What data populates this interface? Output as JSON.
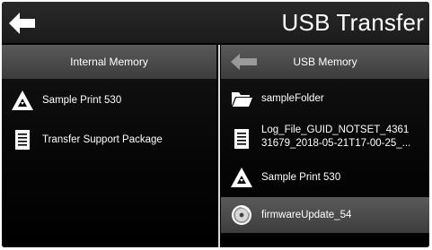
{
  "header": {
    "title": "USB Transfer",
    "back_icon": "arrow-left-icon"
  },
  "internal": {
    "heading": "Internal Memory",
    "items": [
      {
        "label": "Sample Print 530",
        "icon": "print-file-icon"
      },
      {
        "label": "Transfer Support Package",
        "icon": "document-icon"
      }
    ]
  },
  "usb": {
    "heading": "USB Memory",
    "back_icon": "arrow-left-icon",
    "items": [
      {
        "label": "sampleFolder",
        "icon": "folder-icon"
      },
      {
        "label_line1": "Log_File_GUID_NOTSET_4361",
        "label_line2": "31679_2018-05-21T17-00-25_...",
        "icon": "document-icon"
      },
      {
        "label": "Sample Print 530",
        "icon": "print-file-icon"
      },
      {
        "label": "firmwareUpdate_54",
        "icon": "firmware-icon",
        "selected": true
      }
    ]
  },
  "colors": {
    "background": "#000000",
    "header": "#222222",
    "column_header": "#4a4a4a",
    "selected_row": "#4c4c4c",
    "text": "#ffffff"
  }
}
